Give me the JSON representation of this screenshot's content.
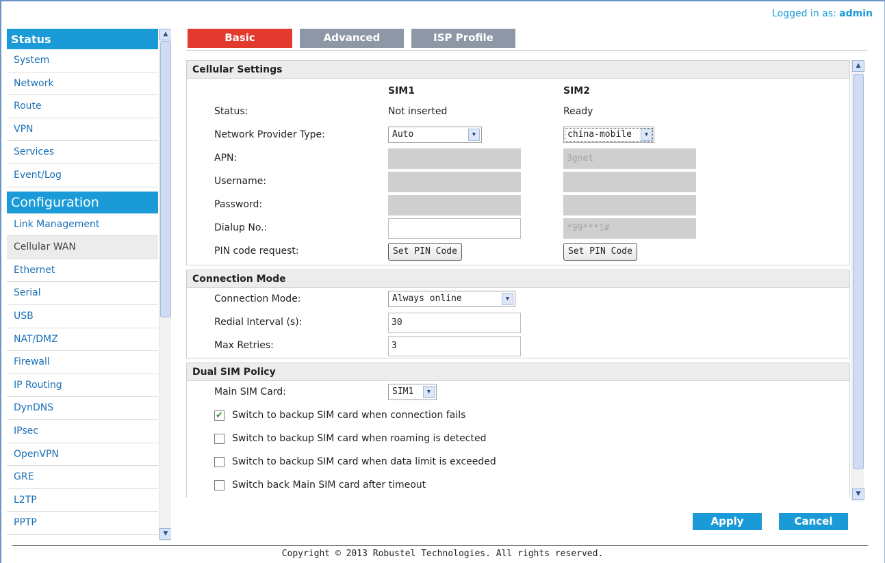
{
  "header": {
    "login_prefix": "Logged in as:",
    "login_user": "admin"
  },
  "sidebar": {
    "status_title": "Status",
    "status_items": [
      "System",
      "Network",
      "Route",
      "VPN",
      "Services",
      "Event/Log"
    ],
    "config_title": "Configuration",
    "config_items": [
      "Link Management",
      "Cellular WAN",
      "Ethernet",
      "Serial",
      "USB",
      "NAT/DMZ",
      "Firewall",
      "IP Routing",
      "DynDNS",
      "IPsec",
      "OpenVPN",
      "GRE",
      "L2TP",
      "PPTP"
    ],
    "active_item": "Cellular WAN"
  },
  "tabs": [
    {
      "label": "Basic",
      "active": true
    },
    {
      "label": "Advanced",
      "active": false
    },
    {
      "label": "ISP Profile",
      "active": false
    }
  ],
  "cellular": {
    "title": "Cellular Settings",
    "sim1_header": "SIM1",
    "sim2_header": "SIM2",
    "status_label": "Status:",
    "sim1_status": "Not inserted",
    "sim2_status": "Ready",
    "provider_label": "Network Provider Type:",
    "sim1_provider": "Auto",
    "sim2_provider": "china-mobile",
    "apn_label": "APN:",
    "sim1_apn": "",
    "sim2_apn": "3gnet",
    "username_label": "Username:",
    "password_label": "Password:",
    "dialup_label": "Dialup No.:",
    "sim1_dialup": "",
    "sim2_dialup": "*99***1#",
    "pin_label": "PIN code request:",
    "pin_button": "Set PIN Code"
  },
  "connection": {
    "title": "Connection Mode",
    "mode_label": "Connection Mode:",
    "mode_value": "Always online",
    "redial_label": "Redial Interval (s):",
    "redial_value": "30",
    "retries_label": "Max Retries:",
    "retries_value": "3"
  },
  "dualsim": {
    "title": "Dual SIM Policy",
    "main_label": "Main SIM Card:",
    "main_value": "SIM1",
    "options": [
      {
        "label": "Switch to backup SIM card when connection fails",
        "checked": true
      },
      {
        "label": "Switch to backup SIM card when roaming is detected",
        "checked": false
      },
      {
        "label": "Switch to backup SIM card when data limit is exceeded",
        "checked": false
      },
      {
        "label": "Switch back Main SIM card after timeout",
        "checked": false
      }
    ]
  },
  "actions": {
    "apply": "Apply",
    "cancel": "Cancel"
  },
  "footer": {
    "copyright": "Copyright © 2013 Robustel Technologies. All rights reserved."
  },
  "colors": {
    "accent": "#1a9bd7",
    "active_tab": "#e23a2f",
    "inactive_tab": "#8d97a5"
  }
}
